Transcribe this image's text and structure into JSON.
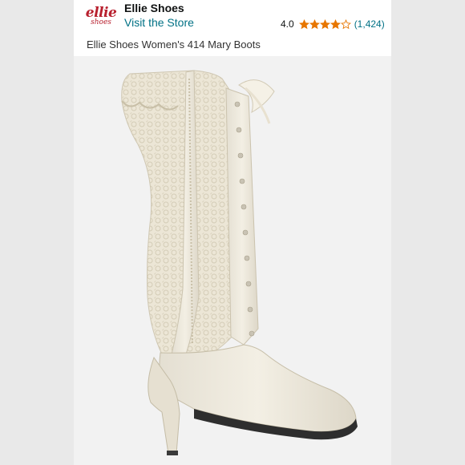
{
  "store": {
    "logo_text": "ellie",
    "logo_subtext": "shoes",
    "brand_name": "Ellie Shoes",
    "visit_link": "Visit the Store"
  },
  "rating": {
    "value": "4.0",
    "stars": 4,
    "count": "(1,424)",
    "star_color": "#e77600"
  },
  "product": {
    "title": "Ellie Shoes Women's 414 Mary Boots",
    "image": "boot-photo"
  },
  "colors": {
    "link": "#007185",
    "logo": "#b8202e"
  }
}
